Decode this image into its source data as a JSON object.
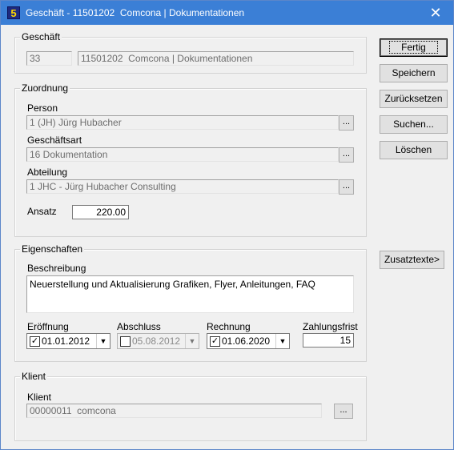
{
  "window": {
    "title": "Geschäft - 11501202  Comcona | Dokumentationen",
    "app_icon": "5",
    "close_glyph": "✕"
  },
  "geschaeft": {
    "legend": "Geschäft",
    "nummer": "33",
    "bezeichnung": "11501202  Comcona | Dokumentationen"
  },
  "zuordnung": {
    "legend": "Zuordnung",
    "person_label": "Person",
    "person_value": "1 (JH) Jürg Hubacher",
    "geschaeftsart_label": "Geschäftsart",
    "geschaeftsart_value": "16 Dokumentation",
    "abteilung_label": "Abteilung",
    "abteilung_value": "1 JHC - Jürg Hubacher Consulting",
    "ansatz_label": "Ansatz",
    "ansatz_value": "220.00",
    "browse_label": "..."
  },
  "eigenschaften": {
    "legend": "Eigenschaften",
    "beschreibung_label": "Beschreibung",
    "beschreibung_value": "Neuerstellung und Aktualisierung Grafiken, Flyer, Anleitungen, FAQ",
    "eroeffnung_label": "Eröffnung",
    "eroeffnung_value": "01.01.2012",
    "eroeffnung_checked": true,
    "abschluss_label": "Abschluss",
    "abschluss_value": "05.08.2012",
    "abschluss_checked": false,
    "rechnung_label": "Rechnung",
    "rechnung_value": "01.06.2020",
    "rechnung_checked": true,
    "zahlungsfrist_label": "Zahlungsfrist",
    "zahlungsfrist_value": "15"
  },
  "klient": {
    "legend": "Klient",
    "klient_label": "Klient",
    "klient_value": "00000011  comcona",
    "browse_label": "..."
  },
  "buttons": {
    "fertig": "Fertig",
    "speichern": "Speichern",
    "zuruecksetzen": "Zurücksetzen",
    "suchen": "Suchen...",
    "loeschen": "Löschen",
    "zusatztexte": "Zusatztexte>"
  },
  "glyphs": {
    "check": "✓",
    "dropdown": "▼"
  }
}
